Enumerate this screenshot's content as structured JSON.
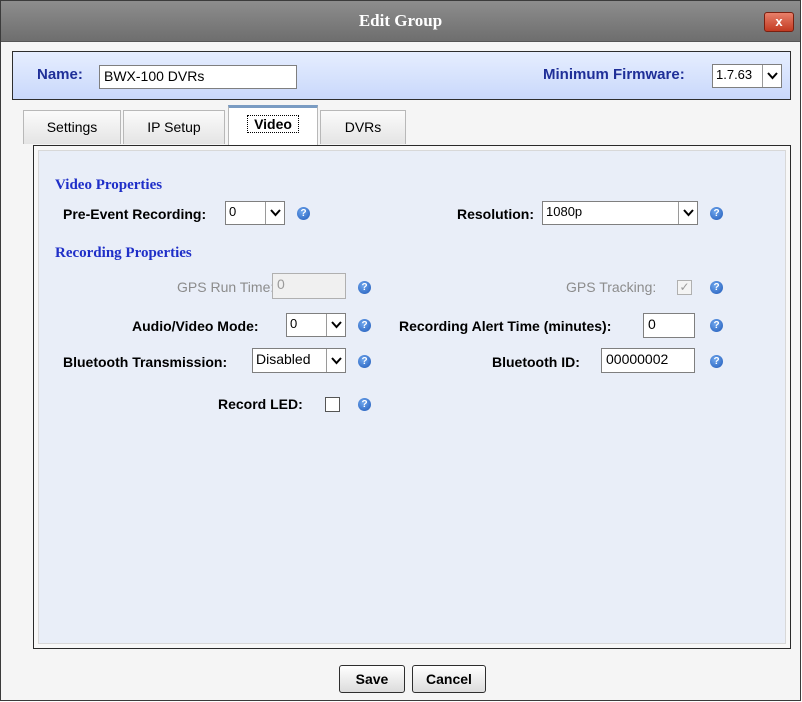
{
  "dialog": {
    "title": "Edit Group",
    "close_glyph": "x"
  },
  "header": {
    "name_label": "Name:",
    "name_value": "BWX-100 DVRs",
    "firmware_label": "Minimum Firmware:",
    "firmware_value": "1.7.63"
  },
  "tabs": [
    {
      "label": "Settings"
    },
    {
      "label": "IP Setup"
    },
    {
      "label": "Video",
      "active": true
    },
    {
      "label": "DVRs"
    }
  ],
  "video_properties": {
    "heading": "Video Properties",
    "pre_event_label": "Pre-Event Recording:",
    "pre_event_value": "0",
    "resolution_label": "Resolution:",
    "resolution_value": "1080p"
  },
  "recording_properties": {
    "heading": "Recording Properties",
    "gps_run_time_label": "GPS Run Time:",
    "gps_run_time_value": "0",
    "gps_tracking_label": "GPS Tracking:",
    "gps_tracking_checked": true,
    "av_mode_label": "Audio/Video Mode:",
    "av_mode_value": "0",
    "alert_time_label": "Recording Alert Time (minutes):",
    "alert_time_value": "0",
    "bt_transmission_label": "Bluetooth Transmission:",
    "bt_transmission_value": "Disabled",
    "bt_id_label": "Bluetooth ID:",
    "bt_id_value": "00000002",
    "record_led_label": "Record LED:",
    "record_led_checked": false
  },
  "help_glyph": "?",
  "check_glyph": "✓",
  "buttons": {
    "save": "Save",
    "cancel": "Cancel"
  },
  "colors": {
    "section_heading": "#1f2fc8",
    "header_label": "#1f2f98",
    "titlebar": "#7d7d7d",
    "close": "#c23a22"
  }
}
